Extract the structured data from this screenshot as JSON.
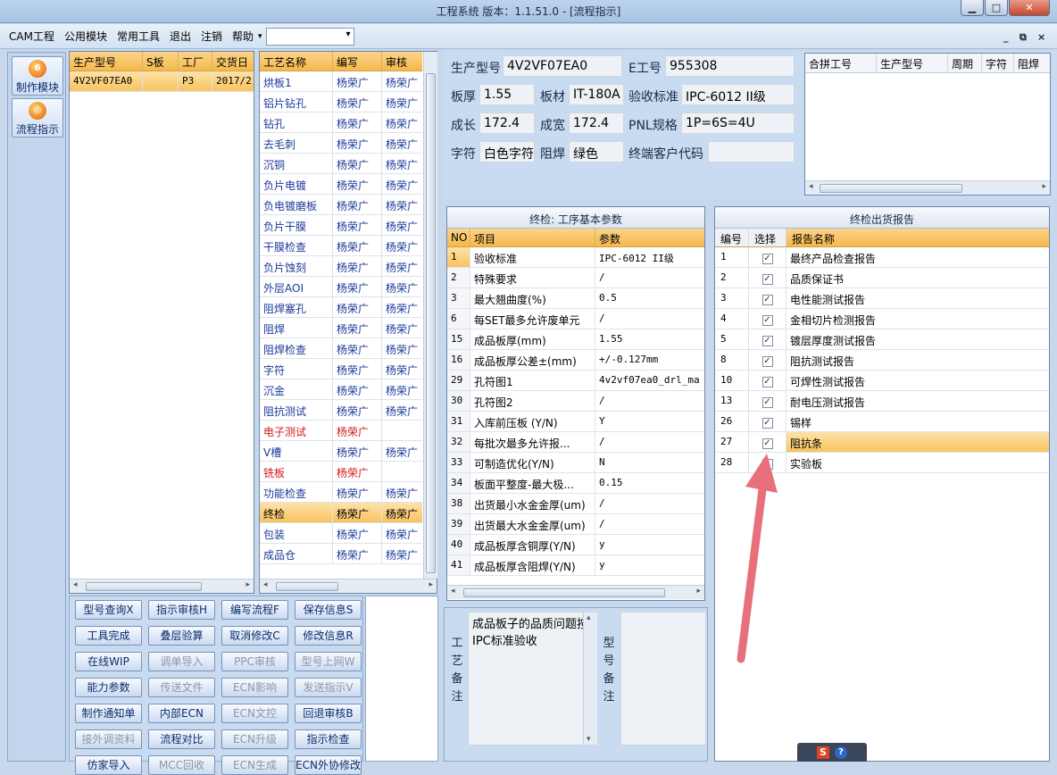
{
  "window": {
    "title": "工程系统  版本：1.1.51.0 - [流程指示]",
    "min": "▁",
    "max": "□",
    "close": "✕"
  },
  "menu": {
    "items": [
      "CAM工程",
      "公用模块",
      "常用工具",
      "退出",
      "注销",
      "帮助"
    ],
    "dropdown_arrow": "▾",
    "mdi": {
      "min": "_",
      "restore": "⧉",
      "close": "×"
    }
  },
  "nav": {
    "items": [
      {
        "label": "制作模块",
        "icon": "6"
      },
      {
        "label": "流程指示",
        "icon": "◎"
      }
    ]
  },
  "models": {
    "headers": [
      "生产型号",
      "S板",
      "工厂",
      "交货日"
    ],
    "rows": [
      [
        "4V2VF07EA0",
        "",
        "P3",
        "2017/2"
      ]
    ]
  },
  "processes": {
    "headers": [
      "工艺名称",
      "编写",
      "审核"
    ],
    "rows": [
      {
        "name": "烘板1",
        "writer": "杨荣广",
        "checker": "杨荣广",
        "red": false
      },
      {
        "name": "铝片钻孔",
        "writer": "杨荣广",
        "checker": "杨荣广",
        "red": false
      },
      {
        "name": "钻孔",
        "writer": "杨荣广",
        "checker": "杨荣广",
        "red": false
      },
      {
        "name": "去毛刺",
        "writer": "杨荣广",
        "checker": "杨荣广",
        "red": false
      },
      {
        "name": "沉铜",
        "writer": "杨荣广",
        "checker": "杨荣广",
        "red": false
      },
      {
        "name": "负片电镀",
        "writer": "杨荣广",
        "checker": "杨荣广",
        "red": false
      },
      {
        "name": "负电镀磨板",
        "writer": "杨荣广",
        "checker": "杨荣广",
        "red": false
      },
      {
        "name": "负片干膜",
        "writer": "杨荣广",
        "checker": "杨荣广",
        "red": false
      },
      {
        "name": "干膜检查",
        "writer": "杨荣广",
        "checker": "杨荣广",
        "red": false
      },
      {
        "name": "负片蚀刻",
        "writer": "杨荣广",
        "checker": "杨荣广",
        "red": false
      },
      {
        "name": "外层AOI",
        "writer": "杨荣广",
        "checker": "杨荣广",
        "red": false
      },
      {
        "name": "阻焊塞孔",
        "writer": "杨荣广",
        "checker": "杨荣广",
        "red": false
      },
      {
        "name": "阻焊",
        "writer": "杨荣广",
        "checker": "杨荣广",
        "red": false
      },
      {
        "name": "阻焊检查",
        "writer": "杨荣广",
        "checker": "杨荣广",
        "red": false
      },
      {
        "name": "字符",
        "writer": "杨荣广",
        "checker": "杨荣广",
        "red": false
      },
      {
        "name": "沉金",
        "writer": "杨荣广",
        "checker": "杨荣广",
        "red": false
      },
      {
        "name": "阻抗测试",
        "writer": "杨荣广",
        "checker": "杨荣广",
        "red": false
      },
      {
        "name": "电子测试",
        "writer": "杨荣广",
        "checker": "",
        "red": true
      },
      {
        "name": "V槽",
        "writer": "杨荣广",
        "checker": "杨荣广",
        "red": false
      },
      {
        "name": "铣板",
        "writer": "杨荣广",
        "checker": "",
        "red": true
      },
      {
        "name": "功能检查",
        "writer": "杨荣广",
        "checker": "杨荣广",
        "red": false
      },
      {
        "name": "终检",
        "writer": "杨荣广",
        "checker": "杨荣广",
        "red": false,
        "selected": true
      },
      {
        "name": "包装",
        "writer": "杨荣广",
        "checker": "杨荣广",
        "red": false
      },
      {
        "name": "成品仓",
        "writer": "杨荣广",
        "checker": "杨荣广",
        "red": false
      }
    ]
  },
  "buttons": [
    {
      "label": "型号查询X",
      "enabled": true
    },
    {
      "label": "指示审核H",
      "enabled": true
    },
    {
      "label": "编写流程F",
      "enabled": true
    },
    {
      "label": "保存信息S",
      "enabled": true
    },
    {
      "label": "工具完成",
      "enabled": true
    },
    {
      "label": "叠层验算",
      "enabled": true
    },
    {
      "label": "取消修改C",
      "enabled": true
    },
    {
      "label": "修改信息R",
      "enabled": true
    },
    {
      "label": "在线WIP",
      "enabled": true
    },
    {
      "label": "调单导入",
      "enabled": false
    },
    {
      "label": "PPC审核",
      "enabled": false
    },
    {
      "label": "型号上网W",
      "enabled": false
    },
    {
      "label": "能力参数",
      "enabled": true
    },
    {
      "label": "传送文件",
      "enabled": false
    },
    {
      "label": "ECN影响",
      "enabled": false
    },
    {
      "label": "发送指示V",
      "enabled": false
    },
    {
      "label": "制作通知单",
      "enabled": true
    },
    {
      "label": "内部ECN",
      "enabled": true
    },
    {
      "label": "ECN文控",
      "enabled": false
    },
    {
      "label": "回退审核B",
      "enabled": true
    },
    {
      "label": "接外调资料",
      "enabled": false
    },
    {
      "label": "流程对比",
      "enabled": true
    },
    {
      "label": "ECN升级",
      "enabled": false
    },
    {
      "label": "指示检查",
      "enabled": true
    },
    {
      "label": "仿家导入",
      "enabled": true
    },
    {
      "label": "MCC回收",
      "enabled": false
    },
    {
      "label": "ECN生成",
      "enabled": false
    },
    {
      "label": "ECN外协修改",
      "enabled": true
    }
  ],
  "info": {
    "model_label": "生产型号",
    "model": "4V2VF07EA0",
    "e_label": "E工号",
    "e_no": "955308",
    "thick_label": "板厚",
    "thick": "1.55",
    "material_label": "板材",
    "material": "IT-180A",
    "std_label": "验收标准",
    "std": "IPC-6012 II级",
    "len_label": "成长",
    "len": "172.4",
    "wid_label": "成宽",
    "wid": "172.4",
    "pnl_label": "PNL规格",
    "pnl": "1P=6S=4U",
    "char_label": "字符",
    "char": "白色字符",
    "mask_label": "阻焊",
    "mask": "绿色",
    "cust_label": "终端客户代码",
    "cust": ""
  },
  "combine": {
    "headers": [
      "合拼工号",
      "生产型号",
      "周期",
      "字符",
      "阻焊"
    ]
  },
  "params": {
    "caption": "终检: 工序基本参数",
    "headers": [
      "NO",
      "项目",
      "参数"
    ],
    "rows": [
      [
        "1",
        "验收标准",
        "IPC-6012 II级"
      ],
      [
        "2",
        "特殊要求",
        "/"
      ],
      [
        "3",
        "最大翘曲度(%)",
        "0.5"
      ],
      [
        "6",
        "每SET最多允许废单元",
        "/"
      ],
      [
        "15",
        "成品板厚(mm)",
        "1.55"
      ],
      [
        "16",
        "成品板厚公差±(mm)",
        "+/-0.127mm"
      ],
      [
        "29",
        "孔符图1",
        "4v2vf07ea0_drl_ma"
      ],
      [
        "30",
        "孔符图2",
        "/"
      ],
      [
        "31",
        "入库前压板 (Y/N)",
        "Y"
      ],
      [
        "32",
        "每批次最多允许报...",
        "/"
      ],
      [
        "33",
        "可制造优化(Y/N)",
        "N"
      ],
      [
        "34",
        "板面平整度-最大极...",
        "0.15"
      ],
      [
        "38",
        "出货最小水金金厚(um)",
        "/"
      ],
      [
        "39",
        "出货最大水金金厚(um)",
        "/"
      ],
      [
        "40",
        "成品板厚含铜厚(Y/N)",
        "y"
      ],
      [
        "41",
        "成品板厚含阻焊(Y/N)",
        "y"
      ]
    ]
  },
  "reports": {
    "caption": "终检出货报告",
    "headers": [
      "编号",
      "选择",
      "报告名称"
    ],
    "check": "✓",
    "rows": [
      [
        "1",
        "最终产品检查报告"
      ],
      [
        "2",
        "品质保证书"
      ],
      [
        "3",
        "电性能测试报告"
      ],
      [
        "4",
        "金相切片检测报告"
      ],
      [
        "5",
        "镀层厚度测试报告"
      ],
      [
        "8",
        "阻抗测试报告"
      ],
      [
        "10",
        "可焊性测试报告"
      ],
      [
        "13",
        "耐电压测试报告"
      ],
      [
        "26",
        "锡样"
      ],
      [
        "27",
        "阻抗条"
      ],
      [
        "28",
        "实验板"
      ]
    ]
  },
  "remarks": {
    "process_label": "工艺备注",
    "process_text": "成品板子的品质问题按IPC标准验收",
    "model_label": "型号备注",
    "model_text": ""
  },
  "scroll": {
    "left": "◂",
    "right": "▸",
    "up": "▴",
    "down": "▾"
  },
  "tray": {
    "icons": [
      "S",
      "?"
    ]
  },
  "colors": {
    "accent": "#f6b94a",
    "arrow": "#e8707a"
  }
}
